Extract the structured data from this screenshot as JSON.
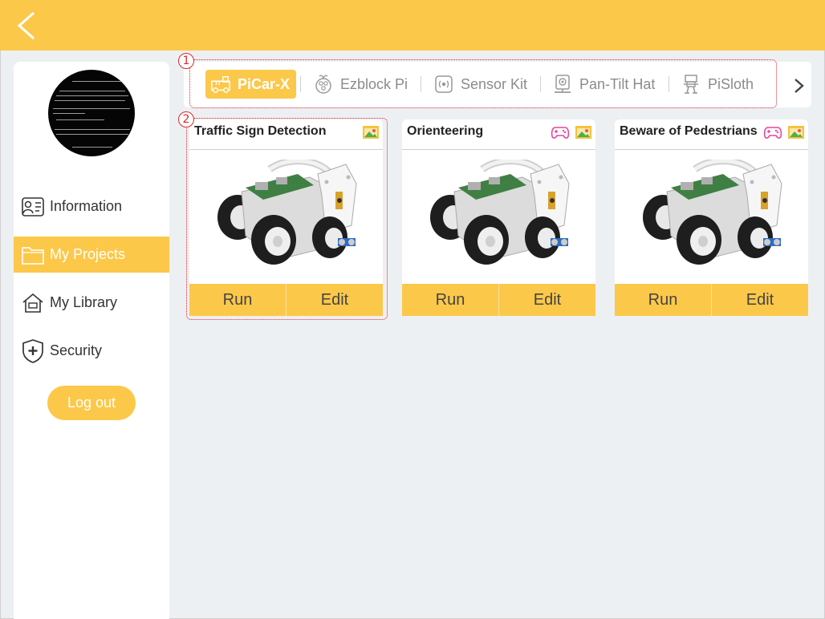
{
  "header": {
    "back_icon": "chevron-left-icon",
    "bar_color": "#fcc84a"
  },
  "sidebar": {
    "items": [
      {
        "label": "Information",
        "icon": "id-card-icon",
        "active": false
      },
      {
        "label": "My Projects",
        "icon": "folder-icon",
        "active": true
      },
      {
        "label": "My Library",
        "icon": "home-library-icon",
        "active": false
      },
      {
        "label": "Security",
        "icon": "shield-plus-icon",
        "active": false
      }
    ],
    "logout_label": "Log out"
  },
  "categories": {
    "items": [
      {
        "label": "PiCar-X",
        "icon": "picar-icon",
        "active": true
      },
      {
        "label": "Ezblock Pi",
        "icon": "raspberry-icon",
        "active": false
      },
      {
        "label": "Sensor Kit",
        "icon": "sensor-icon",
        "active": false
      },
      {
        "label": "Pan-Tilt Hat",
        "icon": "camera-icon",
        "active": false
      },
      {
        "label": "PiSloth",
        "icon": "robot-icon",
        "active": false
      }
    ],
    "next_icon": "chevron-right-icon"
  },
  "annotations": {
    "badge1": "1",
    "badge2": "2"
  },
  "projects": [
    {
      "title": "Traffic Sign Detection",
      "icons": [
        "image-icon"
      ],
      "run_label": "Run",
      "edit_label": "Edit"
    },
    {
      "title": "Orienteering",
      "icons": [
        "gamepad-icon",
        "image-icon"
      ],
      "run_label": "Run",
      "edit_label": "Edit"
    },
    {
      "title": "Beware of Pedestrians",
      "icons": [
        "gamepad-icon",
        "image-icon"
      ],
      "run_label": "Run",
      "edit_label": "Edit"
    }
  ],
  "colors": {
    "accent": "#fcc84a",
    "annotation": "#e0262c",
    "gamepad": "#e8479a"
  }
}
